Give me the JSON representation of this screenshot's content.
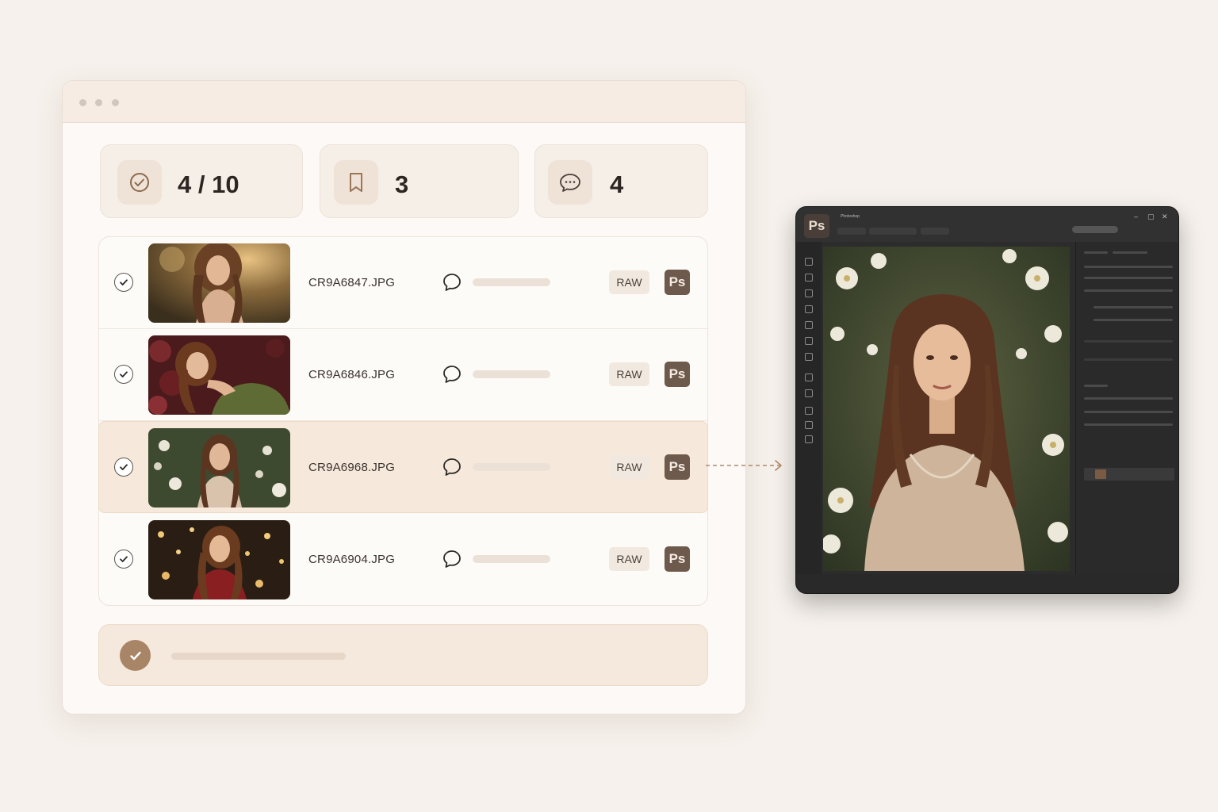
{
  "stats": {
    "approved": {
      "value": "4 / 10",
      "icon": "check-circle-icon"
    },
    "bookmarked": {
      "value": "3",
      "icon": "bookmark-icon"
    },
    "comments": {
      "value": "4",
      "icon": "chat-bubble-icon"
    }
  },
  "files": [
    {
      "name": "CR9A6847.JPG",
      "raw": "RAW",
      "ps": "Ps",
      "checked": true,
      "selected": false
    },
    {
      "name": "CR9A6846.JPG",
      "raw": "RAW",
      "ps": "Ps",
      "checked": true,
      "selected": false
    },
    {
      "name": "CR9A6968.JPG",
      "raw": "RAW",
      "ps": "Ps",
      "checked": true,
      "selected": true
    },
    {
      "name": "CR9A6904.JPG",
      "raw": "RAW",
      "ps": "Ps",
      "checked": true,
      "selected": false
    }
  ],
  "photoshop": {
    "logo": "Ps",
    "app_title": "Photoshop",
    "window_controls": [
      "–",
      "▢",
      "✕"
    ]
  },
  "colors": {
    "background": "#f6f1ec",
    "accent": "#a88567",
    "ps_badge": "#6e5a4c",
    "selected_row": "#f6e9dc",
    "ps_dark": "#2c2c2c"
  }
}
